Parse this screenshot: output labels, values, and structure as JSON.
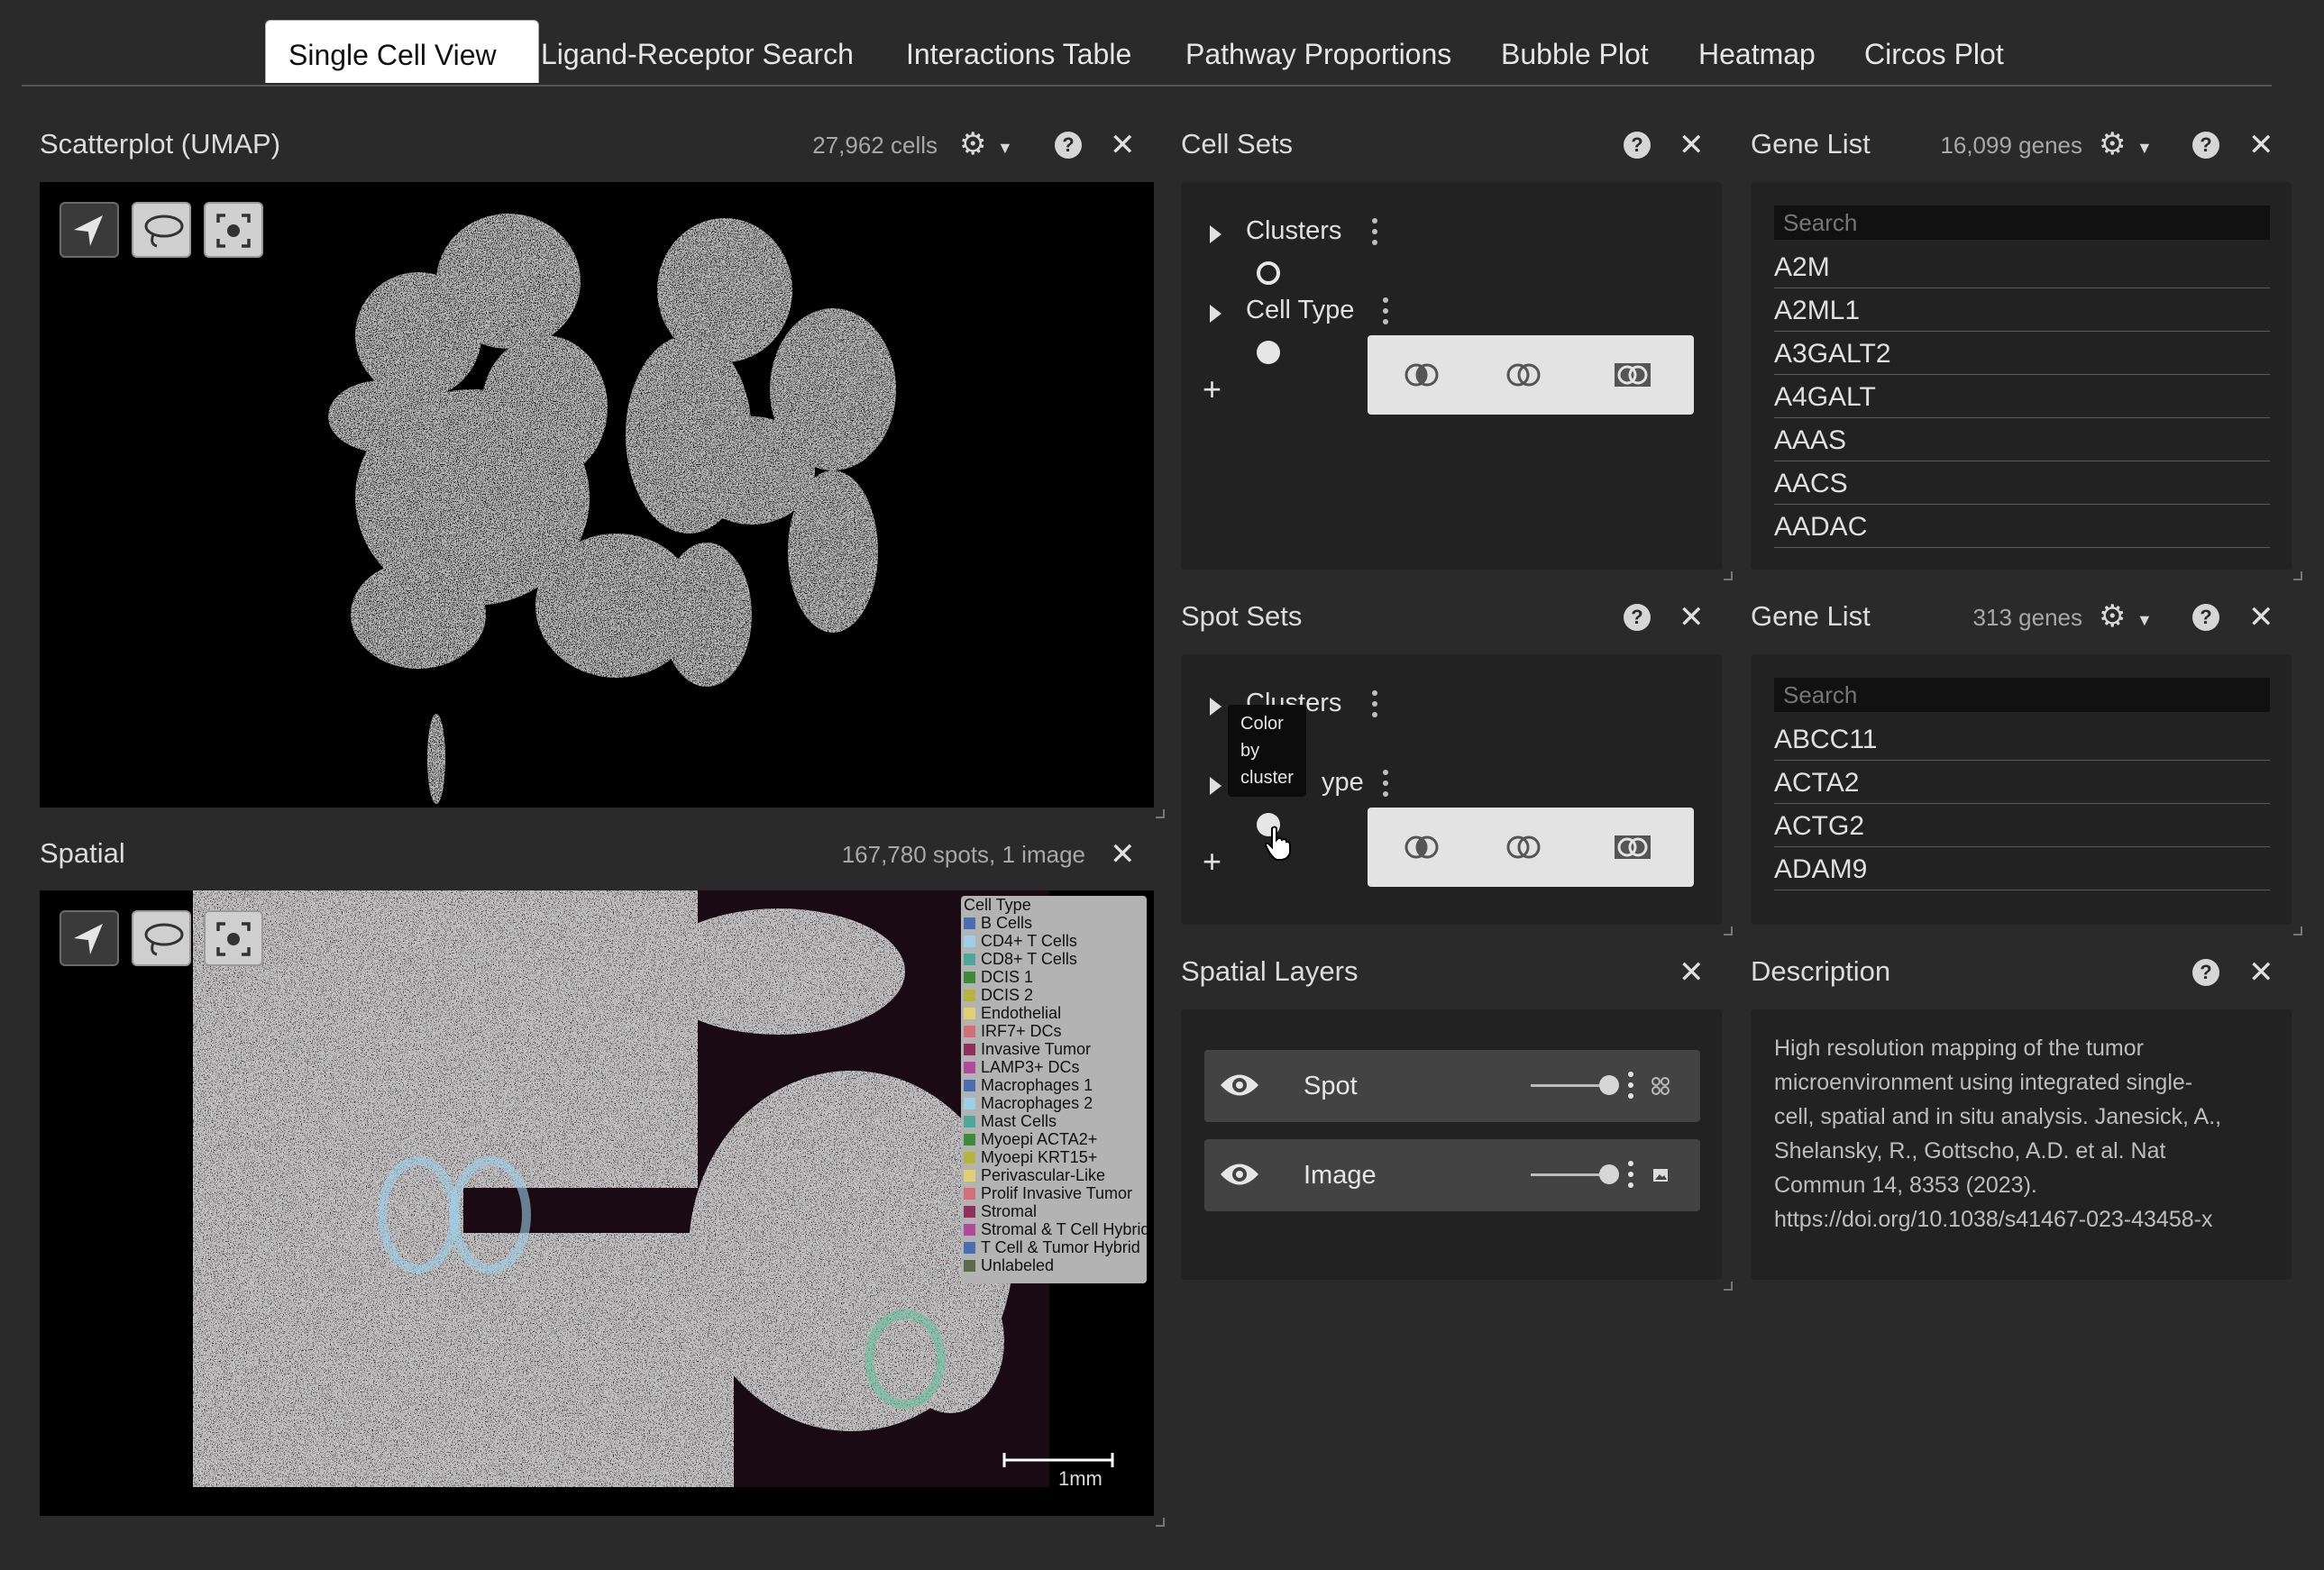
{
  "tabs": [
    {
      "label": "Single Cell View",
      "active": true
    },
    {
      "label": "Ligand-Receptor Search"
    },
    {
      "label": "Interactions Table"
    },
    {
      "label": "Pathway Proportions"
    },
    {
      "label": "Bubble Plot"
    },
    {
      "label": "Heatmap"
    },
    {
      "label": "Circos Plot"
    }
  ],
  "scatterplot": {
    "title": "Scatterplot (UMAP)",
    "count": "27,962 cells"
  },
  "spatial": {
    "title": "Spatial",
    "count": "167,780 spots, 1 image",
    "scalebar": "1mm",
    "legend_title": "Cell Type",
    "legend": [
      {
        "label": "B Cells",
        "color": "#4a6fb0"
      },
      {
        "label": "CD4+ T Cells",
        "color": "#9fcfe8"
      },
      {
        "label": "CD8+ T Cells",
        "color": "#4fa79a"
      },
      {
        "label": "DCIS 1",
        "color": "#3f8a3a"
      },
      {
        "label": "DCIS 2",
        "color": "#b6b43c"
      },
      {
        "label": "Endothelial",
        "color": "#e0d074"
      },
      {
        "label": "IRF7+ DCs",
        "color": "#d2707a"
      },
      {
        "label": "Invasive Tumor",
        "color": "#8e2f5c"
      },
      {
        "label": "LAMP3+ DCs",
        "color": "#b24a9c"
      },
      {
        "label": "Macrophages 1",
        "color": "#4a6fb0"
      },
      {
        "label": "Macrophages 2",
        "color": "#9fcfe8"
      },
      {
        "label": "Mast Cells",
        "color": "#4fa79a"
      },
      {
        "label": "Myoepi ACTA2+",
        "color": "#3f8a3a"
      },
      {
        "label": "Myoepi KRT15+",
        "color": "#b6b43c"
      },
      {
        "label": "Perivascular-Like",
        "color": "#e0d074"
      },
      {
        "label": "Prolif Invasive Tumor",
        "color": "#d2707a"
      },
      {
        "label": "Stromal",
        "color": "#8e2f5c"
      },
      {
        "label": "Stromal & T Cell Hybrid",
        "color": "#b24a9c"
      },
      {
        "label": "T Cell & Tumor Hybrid",
        "color": "#4a6fb0"
      },
      {
        "label": "Unlabeled",
        "color": "#5a6a4a"
      }
    ]
  },
  "cell_sets": {
    "title": "Cell Sets",
    "items": [
      "Clusters",
      "Cell Type"
    ]
  },
  "spot_sets": {
    "title": "Spot Sets",
    "items": [
      "Clusters",
      "Cell Type"
    ],
    "items_visible": [
      "Clusters",
      "ype"
    ]
  },
  "tooltip": {
    "lines": [
      "Color",
      "by",
      "cluster"
    ]
  },
  "gene_list_1": {
    "title": "Gene List",
    "count": "16,099 genes",
    "search_placeholder": "Search",
    "genes": [
      "A2M",
      "A2ML1",
      "A3GALT2",
      "A4GALT",
      "AAAS",
      "AACS",
      "AADAC"
    ]
  },
  "gene_list_2": {
    "title": "Gene List",
    "count": "313 genes",
    "search_placeholder": "Search",
    "genes": [
      "ABCC11",
      "ACTA2",
      "ACTG2",
      "ADAM9"
    ]
  },
  "spatial_layers": {
    "title": "Spatial Layers",
    "layers": [
      {
        "name": "Spot"
      },
      {
        "name": "Image"
      }
    ]
  },
  "description": {
    "title": "Description",
    "lines": [
      "High resolution mapping of the tumor",
      "microenvironment using integrated single-",
      "cell, spatial and in situ analysis. Janesick, A.,",
      "Shelansky, R., Gottscho, A.D. et al. Nat",
      "Commun 14, 8353 (2023).",
      "https://doi.org/10.1038/s41467-023-43458-x"
    ]
  },
  "colors": {
    "background": "#2a2a2a",
    "active_tab": "#ffffff",
    "view_bg": "#000000"
  }
}
